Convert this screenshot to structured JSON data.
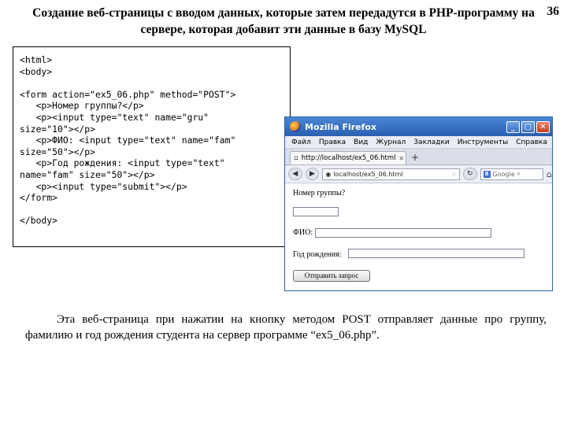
{
  "slide": {
    "title": "Создание веб-страницы с вводом данных, которые затем  передадутся  в PHP-программу  на  сервере,  которая добавит эти данные в базу MySQL",
    "page_number": "36",
    "code": "<html>\n<body>\n\n<form action=\"ex5_06.php\" method=\"POST\">\n   <p>Номер группы?</p>\n   <p><input type=\"text\" name=\"gru\"\nsize=\"10\"></p>\n   <p>ФИО: <input type=\"text\" name=\"fam\"\nsize=\"50\"></p>\n   <p>Год рождения: <input type=\"text\"\nname=\"fam\" size=\"50\"></p>\n   <p><input type=\"submit\"></p>\n</form>\n\n</body>",
    "description": "Эта веб-страница при нажатии на кнопку методом POST отправляет  данные про группу,  фамилию  и  год  рождения студента на  сервер  программе “ex5_06.php”."
  },
  "browser": {
    "window_title": "Mozilla Firefox",
    "menu": [
      "Файл",
      "Правка",
      "Вид",
      "Журнал",
      "Закладки",
      "Инструменты",
      "Справка"
    ],
    "tab_label": "http://localhost/ex5_06.html",
    "new_tab": "+",
    "url": "localhost/ex5_06.html",
    "search_icon_letter": "8",
    "search_placeholder": "Google",
    "form": {
      "group_label": "Номер группы?",
      "fio_label": "ФИО:",
      "year_label": "Год рождения:",
      "submit_label": "Отправить запрос"
    }
  }
}
